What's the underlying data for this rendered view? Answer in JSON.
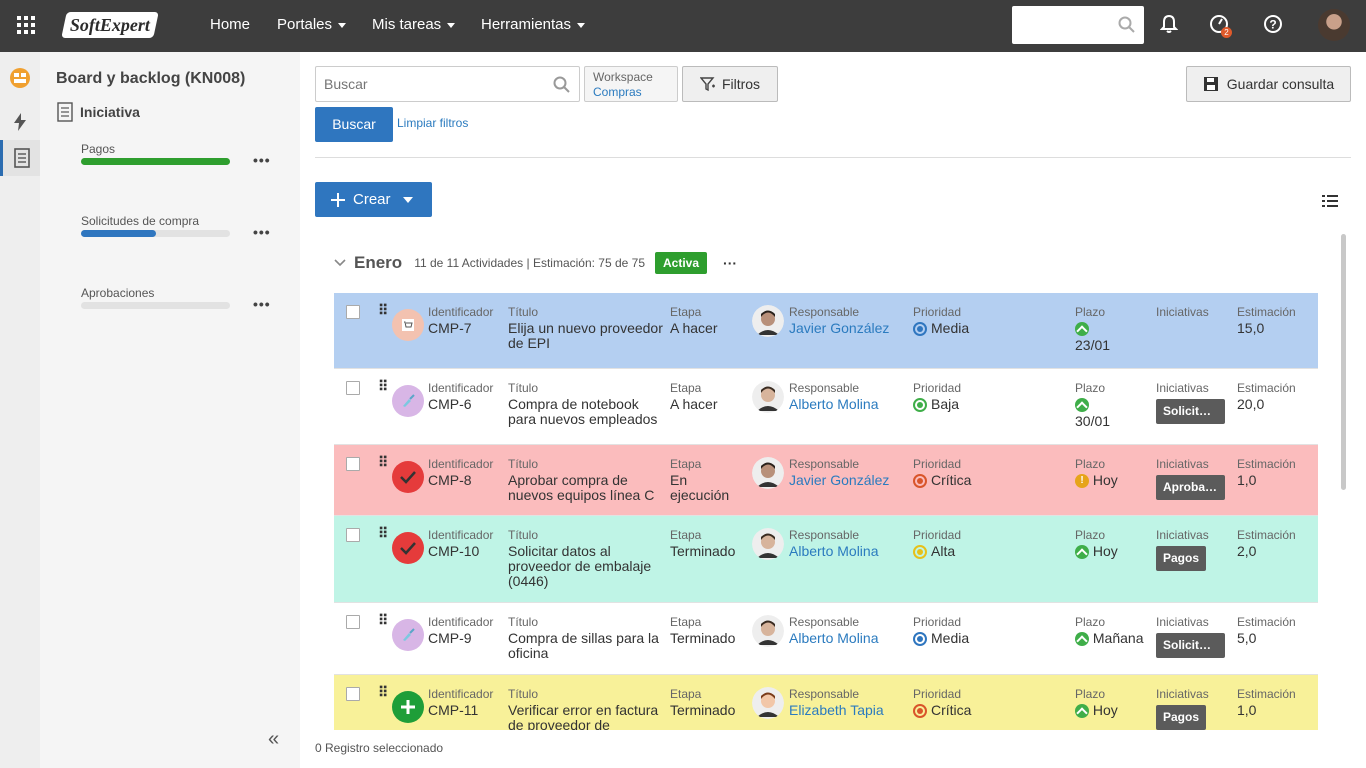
{
  "topbar": {
    "logo": "SoftExpert",
    "nav": [
      {
        "label": "Home",
        "dropdown": false
      },
      {
        "label": "Portales",
        "dropdown": true
      },
      {
        "label": "Mis tareas",
        "dropdown": true
      },
      {
        "label": "Herramientas",
        "dropdown": true
      }
    ],
    "notifications_badge": "2"
  },
  "sidebar": {
    "title": "Board y backlog (KN008)",
    "subtitle": "Iniciativa",
    "initiatives": [
      {
        "label": "Pagos",
        "progress": 1.0,
        "color": "#2e9e2e"
      },
      {
        "label": "Solicitudes de compra",
        "progress": 0.5,
        "color": "#2f76bf"
      },
      {
        "label": "Aprobaciones",
        "progress": 0.0,
        "color": "#2f76bf"
      }
    ]
  },
  "toolbar": {
    "search_placeholder": "Buscar",
    "workspace_label": "Workspace",
    "workspace_value": "Compras",
    "filters_label": "Filtros",
    "save_label": "Guardar consulta",
    "search_button": "Buscar",
    "clear_link": "Limpiar filtros",
    "create_label": "Crear"
  },
  "sprint": {
    "name": "Enero",
    "meta": "11 de 11 Actividades | Estimación: 75 de 75",
    "status": "Activa"
  },
  "headers": {
    "id": "Identificador",
    "title": "Título",
    "stage": "Etapa",
    "owner": "Responsable",
    "priority": "Prioridad",
    "deadline": "Plazo",
    "initiatives": "Iniciativas",
    "estimate": "Estimación"
  },
  "rows": [
    {
      "bg": "#b4cff1",
      "icon": "cart-icon",
      "id": "CMP-7",
      "title": "Elija un nuevo proveedor de EPI",
      "stage": "A hacer",
      "owner": "Javier González",
      "priority": "Media",
      "pcolor": "#2f76bf",
      "deadline_icon": "up",
      "deadline": "23/01",
      "deadline_wrap": true,
      "initiative": "",
      "estimate": "15,0",
      "h": 76
    },
    {
      "bg": "#ffffff",
      "icon": "brush-icon",
      "id": "CMP-6",
      "title": "Compra de notebook para nuevos empleados",
      "stage": "A hacer",
      "owner": "Alberto Molina",
      "priority": "Baja",
      "pcolor": "#3fae49",
      "deadline_icon": "up",
      "deadline": "30/01",
      "deadline_wrap": true,
      "initiative": "Solicitudes de compra",
      "estimate": "20,0",
      "h": 76
    },
    {
      "bg": "#fbbcbd",
      "icon": "check-icon",
      "id": "CMP-8",
      "title": "Aprobar compra de nuevos equipos línea C",
      "stage": "En ejecución",
      "owner": "Javier González",
      "priority": "Crítica",
      "pcolor": "#d9552a",
      "deadline_icon": "warn",
      "deadline": "Hoy",
      "deadline_wrap": false,
      "initiative": "Aprobaciones",
      "estimate": "1,0",
      "h": 71
    },
    {
      "bg": "#bff4e6",
      "icon": "check-icon",
      "id": "CMP-10",
      "title": "Solicitar datos al proveedor de embalaje (0446)",
      "stage": "Terminado",
      "owner": "Alberto Molina",
      "priority": "Alta",
      "pcolor": "#e6c11a",
      "deadline_icon": "up",
      "deadline": "Hoy",
      "deadline_wrap": false,
      "initiative": "Pagos",
      "estimate": "2,0",
      "h": 87
    },
    {
      "bg": "#ffffff",
      "icon": "brush-icon",
      "id": "CMP-9",
      "title": "Compra de sillas para la oficina",
      "stage": "Terminado",
      "owner": "Alberto Molina",
      "priority": "Media",
      "pcolor": "#2f76bf",
      "deadline_icon": "up",
      "deadline": "Mañana",
      "deadline_wrap": false,
      "initiative": "Solicitudes de compra",
      "estimate": "5,0",
      "h": 72
    },
    {
      "bg": "#f8f199",
      "icon": "plus-icon",
      "id": "CMP-11",
      "title": "Verificar error en factura de proveedor de",
      "stage": "Terminado",
      "owner": "Elizabeth Tapia",
      "priority": "Crítica",
      "pcolor": "#d9552a",
      "deadline_icon": "up",
      "deadline": "Hoy",
      "deadline_wrap": false,
      "initiative": "Pagos",
      "estimate": "1,0",
      "h": 72
    }
  ],
  "footer": "0 Registro seleccionado"
}
